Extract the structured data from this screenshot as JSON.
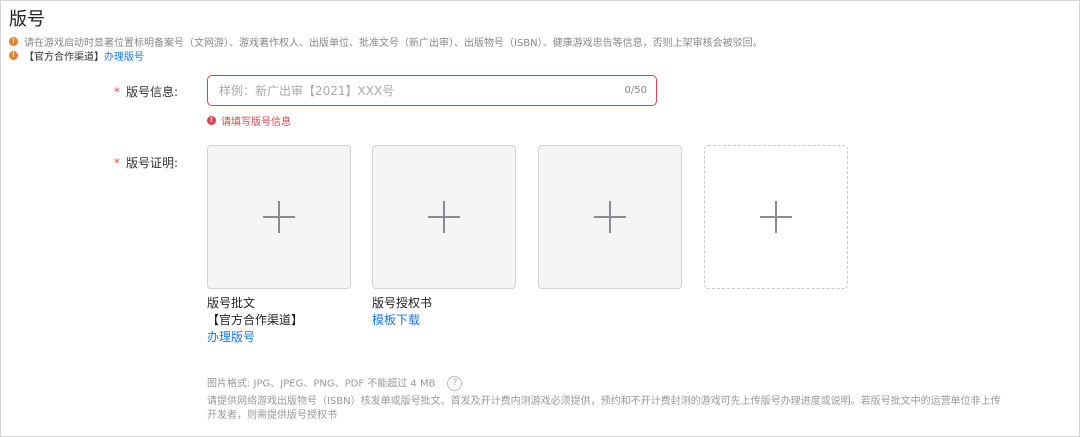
{
  "section": {
    "title": "版号"
  },
  "notices": {
    "line1": "请在游戏启动时显著位置标明备案号（文网游）、游戏著作权人、出版单位、批准文号（新广出审）、出版物号（ISBN）、健康游戏忠告等信息，否则上架审核会被驳回。",
    "channel": "【官方合作渠道】",
    "apply_link": "办理版号",
    "icon": "exclamation-icon",
    "icon_glyph": "!"
  },
  "form": {
    "required_mark": "*",
    "info_label": "版号信息:",
    "info_placeholder": "样例：新广出审【2021】XXX号",
    "info_count": "0/50",
    "info_error": "请填写版号信息",
    "proof_label": "版号证明:"
  },
  "uploads": [
    {
      "caption": "版号批文",
      "sub": "【官方合作渠道】",
      "link": "办理版号"
    },
    {
      "caption": "版号授权书",
      "link": "模板下载"
    },
    {
      "caption": ""
    },
    {
      "caption": ""
    }
  ],
  "hints": {
    "format": "图片格式: JPG、JPEG、PNG、PDF 不能超过 4 MB",
    "help_glyph": "?",
    "desc1": "请提供网络游戏出版物号（ISBN）核发单或版号批文。首发及开计费内测游戏必须提供，预约和不开计费封测的游戏可先上传版号办理进度或说明。若版号批文中的运营单位非上传",
    "desc2": "开发者，则需提供版号授权书"
  },
  "colors": {
    "link": "#1677ff",
    "error": "#e2414b",
    "warning": "#ee7d2a"
  }
}
